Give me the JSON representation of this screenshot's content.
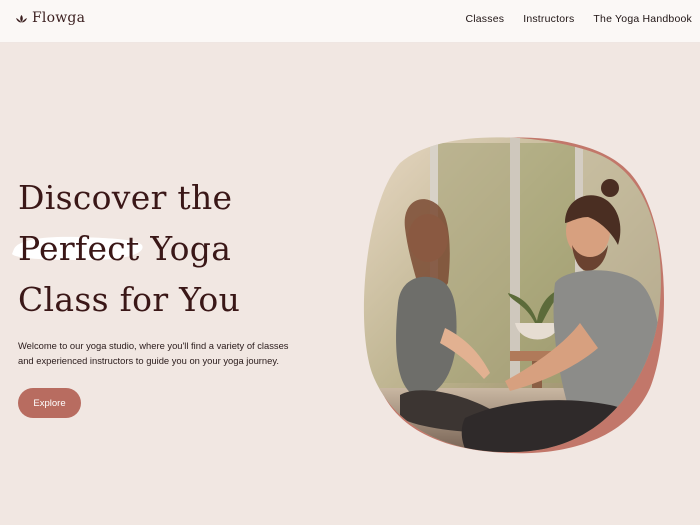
{
  "header": {
    "brand": {
      "name": "Flowga",
      "icon": "lotus-icon"
    },
    "nav": [
      {
        "label": "Classes"
      },
      {
        "label": "Instructors"
      },
      {
        "label": "The Yoga Handbook"
      }
    ]
  },
  "hero": {
    "title_lines": [
      "Discover the",
      "Perfect Yoga",
      "Class for You"
    ],
    "highlighted_word": "Perfect",
    "description_lines": [
      "Welcome to our yoga studio, where you'll find a variety of classes",
      "and experienced instructors to guide you on your yoga journey."
    ],
    "cta_label": "Explore",
    "image": {
      "subject": "photo-couple-seated-facing-each-other"
    }
  },
  "colors": {
    "background": "#f1e7e2",
    "header_bg": "#fbf8f6",
    "accent": "#b86c60",
    "title": "#3a1717"
  }
}
